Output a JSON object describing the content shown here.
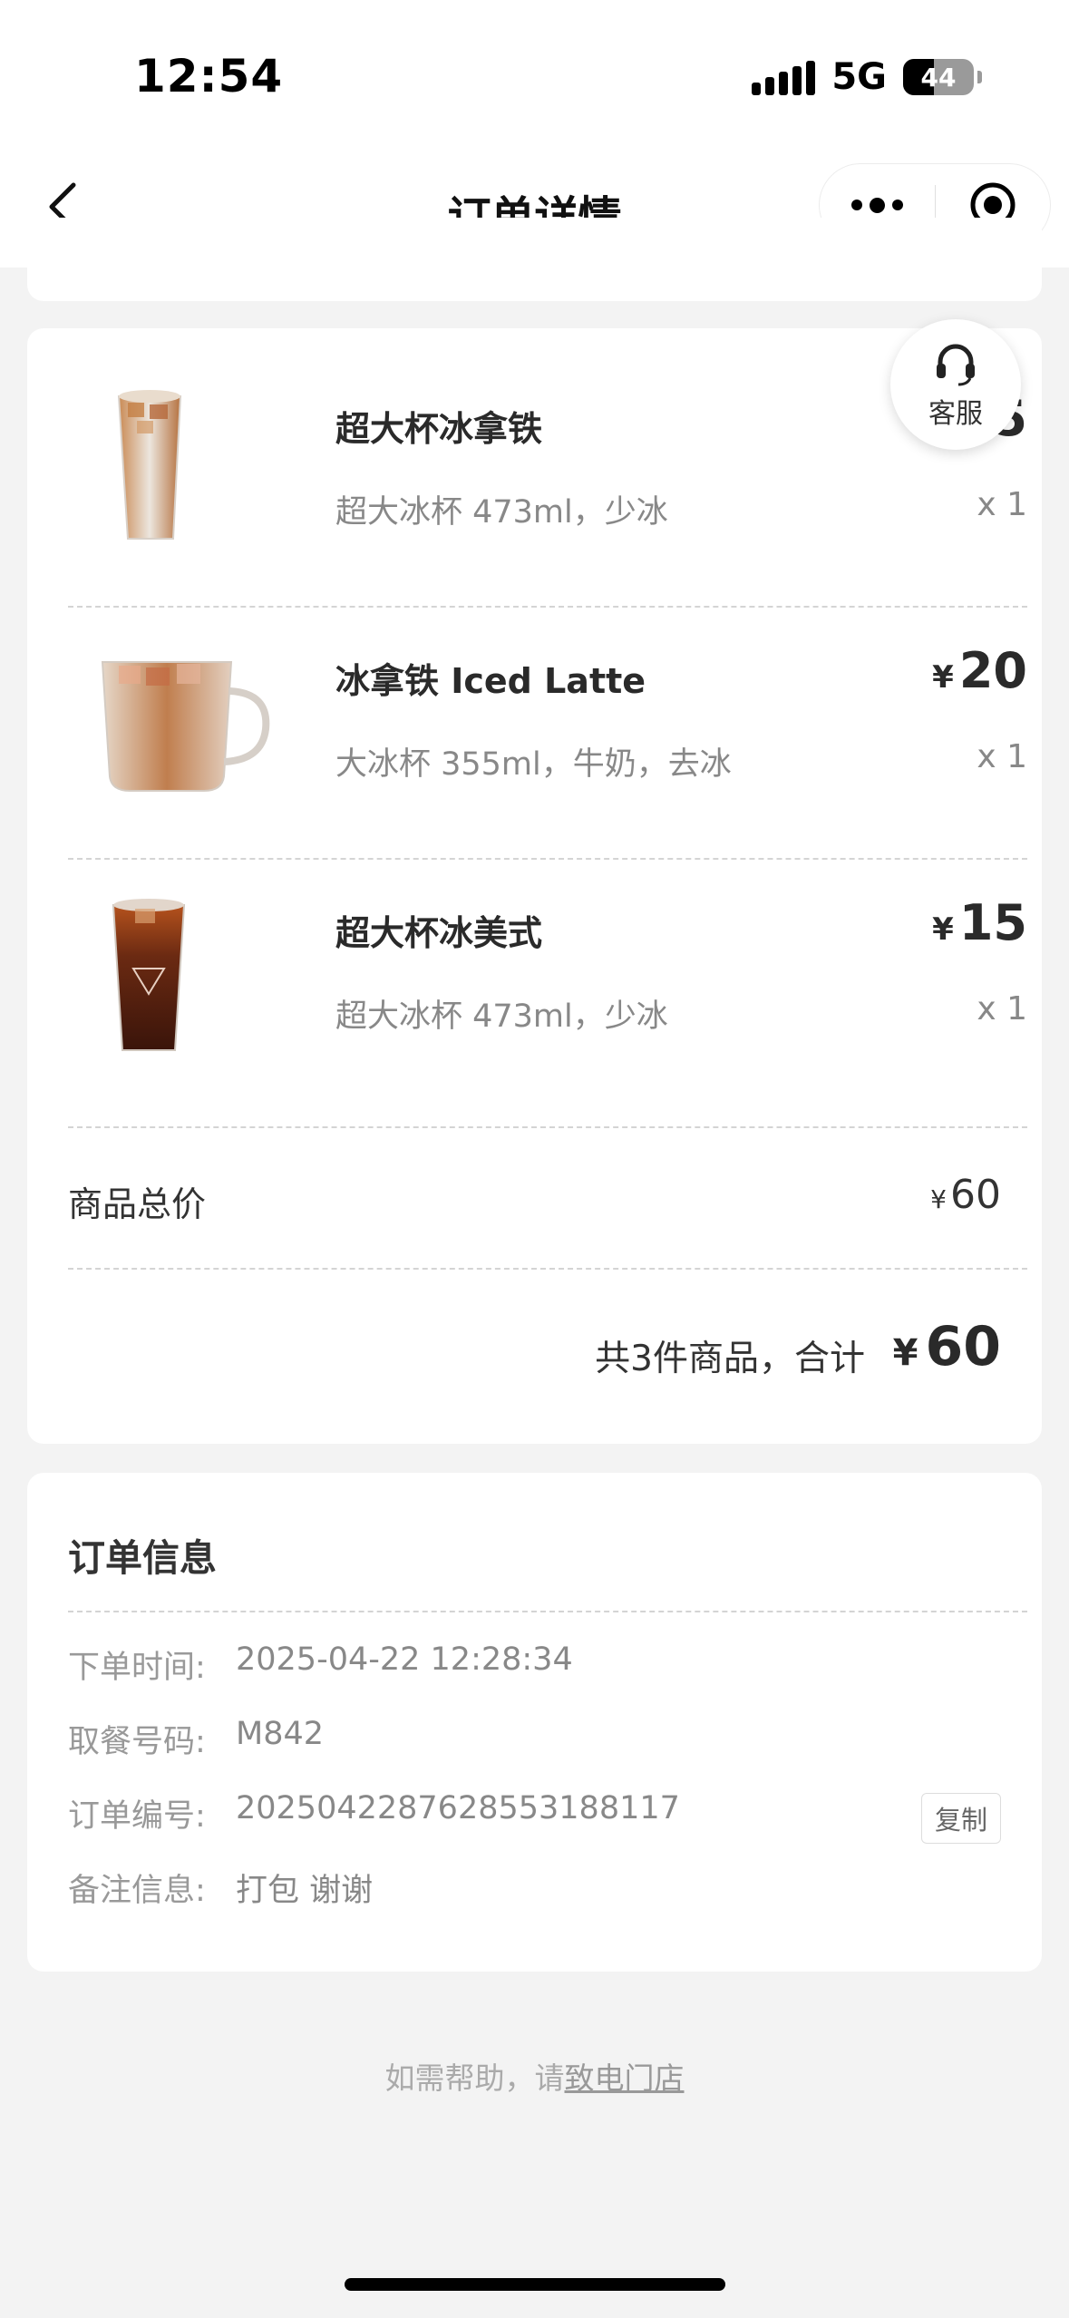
{
  "status_bar": {
    "time": "12:54",
    "network": "5G",
    "battery_level": "44",
    "battery_fraction": 0.44
  },
  "nav": {
    "title": "订单详情",
    "back_icon": "chevron-left-icon",
    "more_icon": "more-dots-icon",
    "close_icon": "target-close-icon"
  },
  "customer_service": {
    "label": "客服",
    "icon": "headset-icon"
  },
  "items": [
    {
      "name": "超大杯冰拿铁",
      "spec": "超大冰杯 473ml，少冰",
      "price": "25",
      "currency": "¥",
      "qty": "x 1",
      "image": "iced-latte-large-cup"
    },
    {
      "name": "冰拿铁 Iced Latte",
      "spec": "大冰杯 355ml，牛奶，去冰",
      "price": "20",
      "currency": "¥",
      "qty": "x 1",
      "image": "iced-latte-glass-mug"
    },
    {
      "name": "超大杯冰美式",
      "spec": "超大冰杯 473ml，少冰",
      "price": "15",
      "currency": "¥",
      "qty": "x 1",
      "image": "iced-americano-cup"
    }
  ],
  "summary": {
    "subtotal_label": "商品总价",
    "subtotal_currency": "¥",
    "subtotal_value": "60",
    "total_text": "共3件商品，合计",
    "total_currency": "¥",
    "total_value": "60"
  },
  "order_info": {
    "title": "订单信息",
    "rows": [
      {
        "label": "下单时间:",
        "value": "2025-04-22 12:28:34"
      },
      {
        "label": "取餐号码:",
        "value": "M842"
      },
      {
        "label": "订单编号:",
        "value": "2025042287628553188117"
      },
      {
        "label": "备注信息:",
        "value": "打包 谢谢"
      }
    ],
    "copy_label": "复制"
  },
  "help": {
    "prefix": "如需帮助，请",
    "link": "致电门店"
  }
}
